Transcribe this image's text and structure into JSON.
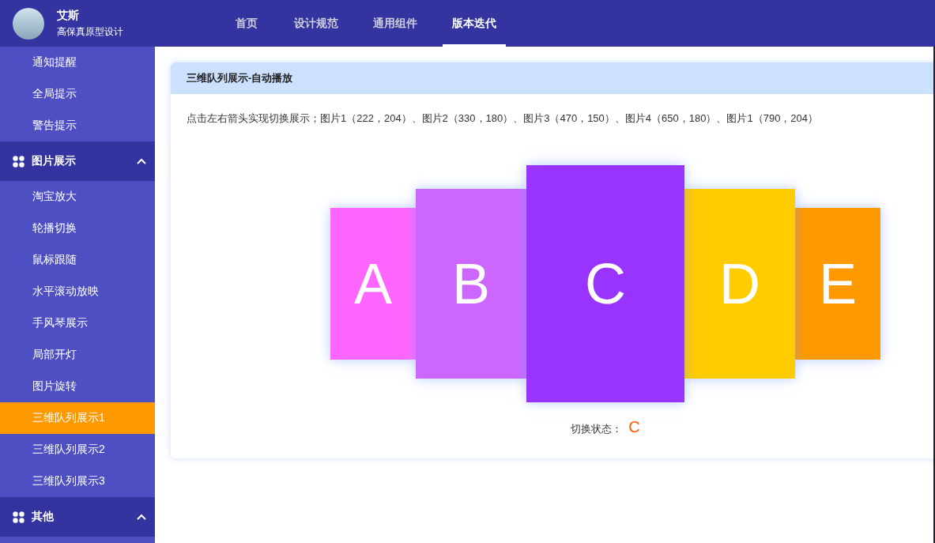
{
  "header": {
    "user_name": "艾斯",
    "subtitle": "高保真原型设计",
    "nav": [
      {
        "label": "首页",
        "selected": false
      },
      {
        "label": "设计规范",
        "selected": false
      },
      {
        "label": "通用组件",
        "selected": false
      },
      {
        "label": "版本迭代",
        "selected": true
      }
    ]
  },
  "sidebar": {
    "items": [
      {
        "kind": "item",
        "label": "通知提醒",
        "selected": false
      },
      {
        "kind": "item",
        "label": "全局提示",
        "selected": false
      },
      {
        "kind": "item",
        "label": "警告提示",
        "selected": false
      },
      {
        "kind": "group",
        "label": "图片展示",
        "expanded": true,
        "children": [
          {
            "label": "淘宝放大",
            "selected": false
          },
          {
            "label": "轮播切换",
            "selected": false
          },
          {
            "label": "鼠标跟随",
            "selected": false
          },
          {
            "label": "水平滚动放映",
            "selected": false
          },
          {
            "label": "手风琴展示",
            "selected": false
          },
          {
            "label": "局部开灯",
            "selected": false
          },
          {
            "label": "图片旋转",
            "selected": false
          },
          {
            "label": "三维队列展示1",
            "selected": true
          },
          {
            "label": "三维队列展示2",
            "selected": false
          },
          {
            "label": "三维队列展示3",
            "selected": false
          }
        ]
      },
      {
        "kind": "group",
        "label": "其他",
        "expanded": true
      }
    ]
  },
  "panel": {
    "title": "三维队列展示-自动播放",
    "description": "点击左右箭头实现切换展示；图片1（222，204）、图片2（330，180）、图片3（470，150）、图片4（650，180）、图片1（790，204）",
    "cards": [
      {
        "label": "A",
        "color": "#ff66ff",
        "selected": false
      },
      {
        "label": "B",
        "color": "#cc66ff",
        "selected": false
      },
      {
        "label": "C",
        "color": "#9933ff",
        "selected": true
      },
      {
        "label": "D",
        "color": "#ffcc00",
        "selected": false
      },
      {
        "label": "E",
        "color": "#ff9900",
        "selected": false
      }
    ],
    "status_label": "切换状态：",
    "status_value": "C"
  }
}
